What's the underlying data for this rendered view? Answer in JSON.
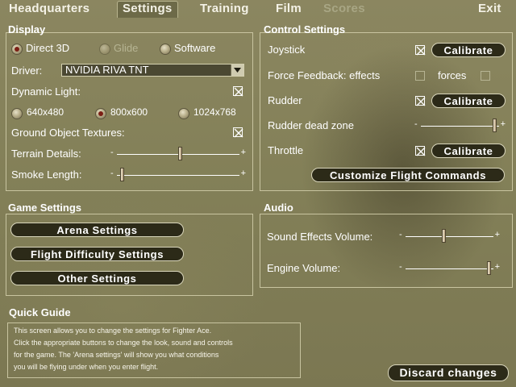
{
  "tabs": [
    {
      "label": "Headquarters",
      "state": "normal"
    },
    {
      "label": "Settings",
      "state": "active"
    },
    {
      "label": "Training",
      "state": "normal"
    },
    {
      "label": "Film",
      "state": "normal"
    },
    {
      "label": "Scores",
      "state": "disabled"
    },
    {
      "label": "Exit",
      "state": "normal"
    }
  ],
  "display": {
    "title": "Display",
    "renderer": {
      "direct3d": "Direct 3D",
      "glide": "Glide",
      "software": "Software",
      "selected": "Direct 3D"
    },
    "driver_label": "Driver:",
    "driver_value": "NVIDIA RIVA TNT",
    "dynamic_light_label": "Dynamic Light:",
    "dynamic_light_checked": true,
    "resolutions": [
      "640x480",
      "800x600",
      "1024x768"
    ],
    "resolution_selected": "800x600",
    "ground_textures_label": "Ground Object Textures:",
    "ground_textures_checked": true,
    "terrain_label": "Terrain Details:",
    "terrain_level": 0.52,
    "smoke_label": "Smoke Length:",
    "smoke_level": 0.03,
    "minus": "-",
    "plus": "+"
  },
  "control": {
    "title": "Control Settings",
    "joystick_label": "Joystick",
    "joystick_checked": true,
    "calibrate_label": "Calibrate",
    "ff_label": "Force Feedback: effects",
    "ff_effects_checked": false,
    "forces_label": "forces",
    "ff_forces_checked": false,
    "rudder_label": "Rudder",
    "rudder_checked": true,
    "rudder_dead_label": "Rudder dead zone",
    "rudder_dead_level": 0.97,
    "throttle_label": "Throttle",
    "throttle_checked": true,
    "customize_label": "Customize Flight Commands"
  },
  "game": {
    "title": "Game Settings",
    "arena_label": "Arena Settings",
    "difficulty_label": "Flight Difficulty Settings",
    "other_label": "Other Settings"
  },
  "audio": {
    "title": "Audio",
    "sfx_label": "Sound Effects Volume:",
    "sfx_level": 0.43,
    "engine_label": "Engine Volume:",
    "engine_level": 0.97
  },
  "guide": {
    "title": "Quick Guide",
    "lines": [
      "This screen allows you to change the settings for Fighter Ace.",
      "Click the appropriate buttons to change the look, sound and controls",
      "for the game. The 'Arena settings' will show you what conditions",
      "you will be flying under when you enter flight."
    ]
  },
  "discard_label": "Discard changes",
  "colors": {
    "accent_dark": "#2c2a18",
    "check_red": "#7b1f15",
    "panel_border": "#c8c4a0"
  }
}
